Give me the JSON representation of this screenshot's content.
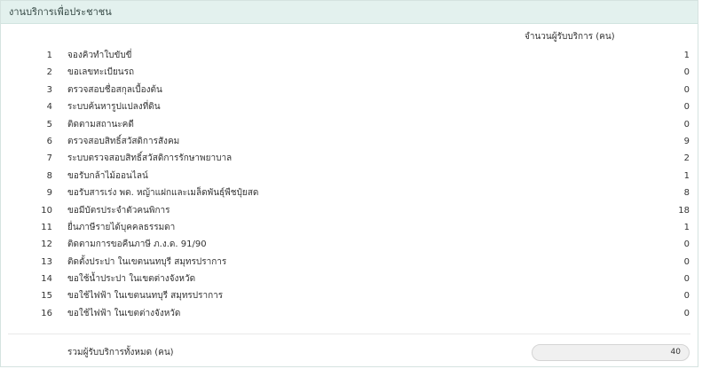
{
  "header": {
    "title": "งานบริการเพื่อประชาชน"
  },
  "column_header": "จำนวนผู้รับบริการ (คน)",
  "services": [
    {
      "no": "1",
      "name": "จองคิวทำใบขับขี่",
      "count": "1"
    },
    {
      "no": "2",
      "name": "ขอเลขทะเบียนรถ",
      "count": "0"
    },
    {
      "no": "3",
      "name": "ตรวจสอบชื่อสกุลเบื้องต้น",
      "count": "0"
    },
    {
      "no": "4",
      "name": "ระบบค้นหารูปแปลงที่ดิน",
      "count": "0"
    },
    {
      "no": "5",
      "name": "ติดตามสถานะคดี",
      "count": "0"
    },
    {
      "no": "6",
      "name": "ตรวจสอบสิทธิ์สวัสดิการสังคม",
      "count": "9"
    },
    {
      "no": "7",
      "name": "ระบบตรวจสอบสิทธิ์สวัสดิการรักษาพยาบาล",
      "count": "2"
    },
    {
      "no": "8",
      "name": "ขอรับกล้าไม้ออนไลน์",
      "count": "1"
    },
    {
      "no": "9",
      "name": "ขอรับสารเร่ง พด. หญ้าแฝกและเมล็ดพันธุ์พืชปุ๋ยสด",
      "count": "8"
    },
    {
      "no": "10",
      "name": "ขอมีบัตรประจำตัวคนพิการ",
      "count": "18"
    },
    {
      "no": "11",
      "name": "ยื่นภาษีรายได้บุคคลธรรมดา",
      "count": "1"
    },
    {
      "no": "12",
      "name": "ติดตามการขอคืนภาษี ภ.ง.ด. 91/90",
      "count": "0"
    },
    {
      "no": "13",
      "name": "ติดตั้งประปา ในเขตนนทบุรี สมุทรปราการ",
      "count": "0"
    },
    {
      "no": "14",
      "name": "ขอใช้น้ำประปา ในเขตต่างจังหวัด",
      "count": "0"
    },
    {
      "no": "15",
      "name": "ขอใช้ไฟฟ้า ในเขตนนทบุรี สมุทรปราการ",
      "count": "0"
    },
    {
      "no": "16",
      "name": "ขอใช้ไฟฟ้า ในเขตต่างจังหวัด",
      "count": "0"
    }
  ],
  "total": {
    "label": "รวมผู้รับบริการทั้งหมด (คน)",
    "value": "40"
  }
}
